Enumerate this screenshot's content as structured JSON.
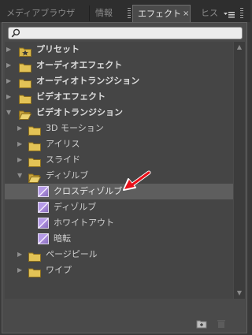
{
  "tabs": [
    {
      "label": "メディアブラウザ",
      "active": false
    },
    {
      "label": "情報",
      "active": false
    },
    {
      "label": "エフェクト",
      "active": true
    },
    {
      "label": "ヒス",
      "active": false
    }
  ],
  "tab_close_glyph": "×",
  "panel_menu_icon": "panel-menu-icon",
  "search": {
    "value": "",
    "icon": "search-icon"
  },
  "tree": [
    {
      "label": "プリセット",
      "level": 0,
      "expanded": false,
      "kind": "preset-folder"
    },
    {
      "label": "オーディオエフェクト",
      "level": 0,
      "expanded": false,
      "kind": "folder"
    },
    {
      "label": "オーディオトランジション",
      "level": 0,
      "expanded": false,
      "kind": "folder"
    },
    {
      "label": "ビデオエフェクト",
      "level": 0,
      "expanded": false,
      "kind": "folder"
    },
    {
      "label": "ビデオトランジション",
      "level": 0,
      "expanded": true,
      "kind": "folder"
    },
    {
      "label": "3D モーション",
      "level": 1,
      "expanded": false,
      "kind": "folder"
    },
    {
      "label": "アイリス",
      "level": 1,
      "expanded": false,
      "kind": "folder"
    },
    {
      "label": "スライド",
      "level": 1,
      "expanded": false,
      "kind": "folder"
    },
    {
      "label": "ディゾルブ",
      "level": 1,
      "expanded": true,
      "kind": "folder"
    },
    {
      "label": "クロスディゾルブ",
      "level": 2,
      "kind": "effect",
      "selected": true
    },
    {
      "label": "ディゾルブ",
      "level": 2,
      "kind": "effect"
    },
    {
      "label": "ホワイトアウト",
      "level": 2,
      "kind": "effect"
    },
    {
      "label": "暗転",
      "level": 2,
      "kind": "effect"
    },
    {
      "label": "ページピール",
      "level": 1,
      "expanded": false,
      "kind": "folder"
    },
    {
      "label": "ワイプ",
      "level": 1,
      "expanded": false,
      "kind": "folder"
    }
  ],
  "footer": {
    "new_bin_icon": "new-custom-bin-icon",
    "delete_icon": "trash-icon"
  },
  "annotation": {
    "icon": "red-arrow-icon",
    "color": "#e8101a"
  }
}
